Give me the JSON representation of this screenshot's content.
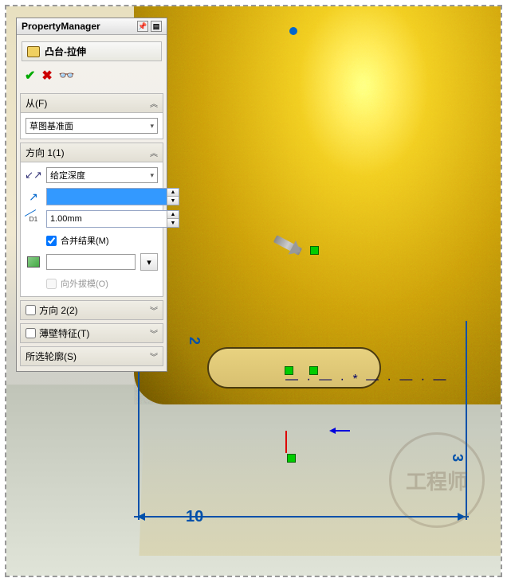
{
  "panel": {
    "title": "PropertyManager",
    "feature_name": "凸台-拉伸",
    "from": {
      "header": "从(F)",
      "value": "草图基准面"
    },
    "direction1": {
      "header": "方向 1(1)",
      "end_condition": "给定深度",
      "dir_value": "",
      "depth_label": "D1",
      "depth_value": "1.00mm",
      "merge_label": "合并结果(M)",
      "merge_checked": true,
      "draft_on": false,
      "draft_out_label": "向外拔模(O)"
    },
    "direction2": {
      "header": "方向 2(2)"
    },
    "thin": {
      "header": "薄壁特征(T)"
    },
    "contours": {
      "header": "所选轮廓(S)"
    }
  },
  "dims": {
    "width": "10",
    "left_v": "2",
    "right_v": "3"
  },
  "watermark": "工程师"
}
